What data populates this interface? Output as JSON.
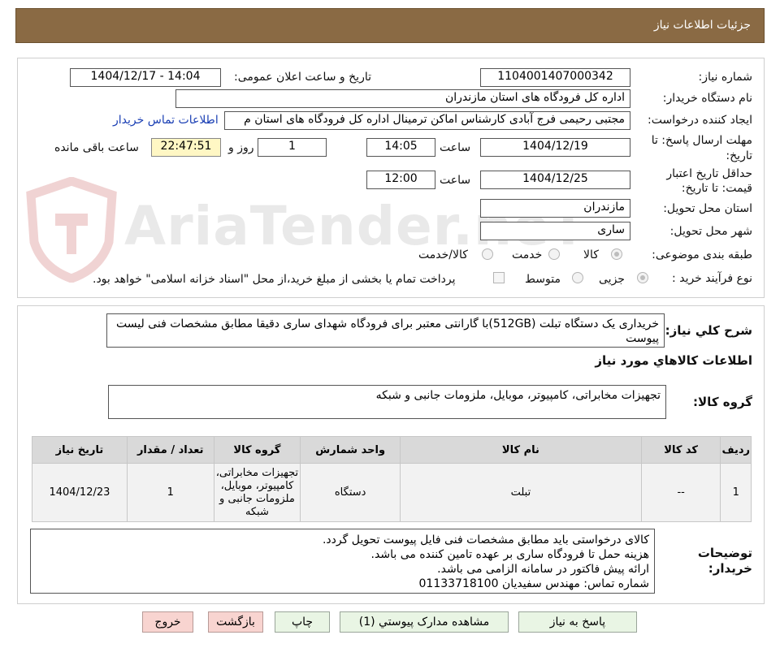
{
  "header": {
    "title": "جزئیات اطلاعات نیاز"
  },
  "watermark": {
    "text": "AriaTender.neT"
  },
  "form": {
    "need_number": {
      "label": "شماره نیاز:",
      "value": "1104001407000342"
    },
    "announce_date": {
      "label": "تاریخ و ساعت اعلان عمومی:",
      "value": "1404/12/17 - 14:04"
    },
    "buyer_org": {
      "label": "نام دستگاه خریدار:",
      "value": "اداره کل فرودگاه های استان مازندران"
    },
    "requester": {
      "label": "ایجاد کننده درخواست:",
      "value": "مجتبی رحیمی فرج آبادی کارشناس اماکن ترمینال اداره کل فرودگاه های استان م",
      "contact_link": "اطلاعات تماس خریدار"
    },
    "reply_deadline": {
      "label_line1": "مهلت ارسال پاسخ: تا",
      "label_line2": "تاریخ:",
      "date": "1404/12/19",
      "time_label": "ساعت",
      "time": "14:05",
      "days": "1",
      "days_label": "روز و",
      "remaining": "22:47:51",
      "remaining_label": "ساعت باقی مانده"
    },
    "price_validity": {
      "label_line1": "حداقل تاریخ اعتبار",
      "label_line2": "قیمت: تا تاریخ:",
      "date": "1404/12/25",
      "time_label": "ساعت",
      "time": "12:00"
    },
    "province": {
      "label": "استان محل تحویل:",
      "value": "مازندران"
    },
    "city": {
      "label": "شهر محل تحویل:",
      "value": "ساری"
    },
    "category": {
      "label": "طبقه بندی موضوعی:",
      "options": [
        "کالا",
        "خدمت",
        "کالا/خدمت"
      ],
      "selected": "کالا"
    },
    "purchase_type": {
      "label": "نوع فرآیند خرید :",
      "options": [
        "جزیی",
        "متوسط"
      ],
      "selected": "جزیی",
      "treasury_note": "پرداخت تمام یا بخشی از مبلغ خرید،از محل \"اسناد خزانه اسلامی\" خواهد بود."
    }
  },
  "summary": {
    "label": "شرح کلي نياز:",
    "text": "خریداری یک دستگاه تبلت (512GB)با گارانتی معتبر برای فرودگاه شهدای ساری دقیقا مطابق مشخصات فنی لیست پیوست"
  },
  "goods_section": {
    "title": "اطلاعات کالاهاي مورد نياز",
    "group_label": "گروه کالا:",
    "group_value": "تجهیزات مخابراتی، کامپیوتر، موبایل، ملزومات جانبی و شبکه"
  },
  "items_table": {
    "headers": [
      "رديف",
      "کد کالا",
      "نام کالا",
      "واحد شمارش",
      "گروه کالا",
      "تعداد / مقدار",
      "تاريخ نياز"
    ],
    "rows": [
      [
        "1",
        "--",
        "تبلت",
        "دستگاه",
        "تجهیزات مخابراتی، کامپیوتر، موبایل، ملزومات جانبی و شبکه",
        "1",
        "1404/12/23"
      ]
    ]
  },
  "buyer_notes": {
    "label_line1": "توضیحات",
    "label_line2": "خریدار:",
    "lines": [
      "کالای درخواستی باید مطابق مشخصات فنی فایل پیوست تحویل گردد.",
      "هزینه حمل تا فرودگاه ساری بر عهده تامین کننده می باشد.",
      "ارائه پیش فاکتور در سامانه الزامی می باشد.",
      "شماره تماس: مهندس سفیدیان    01133718100"
    ]
  },
  "buttons": {
    "reply": "پاسخ به نياز",
    "attachments": "مشاهده مدارک پیوستي (1)",
    "print": "چاپ",
    "back": "بازگشت",
    "exit": "خروج"
  },
  "colors": {
    "header_bg": "#8a6a44",
    "timer_bg": "#fff7c4",
    "button_green": "#e9f5e4",
    "button_red": "#f8d4d0",
    "link": "#1a3fb4"
  }
}
